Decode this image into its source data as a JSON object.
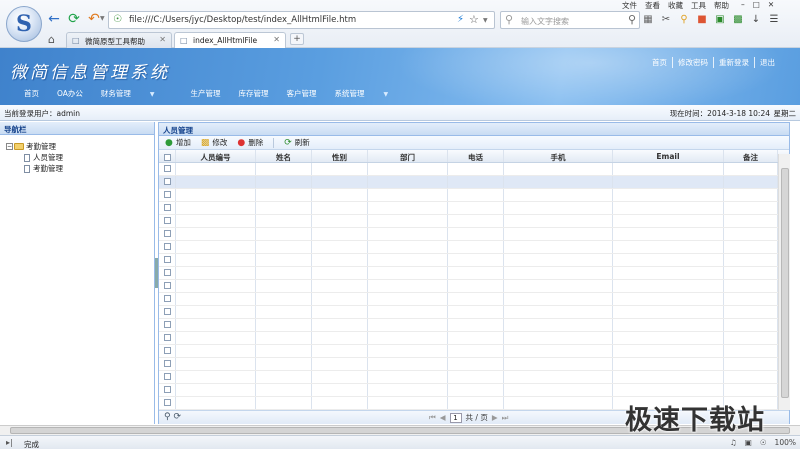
{
  "browser": {
    "url": "file:///C:/Users/jyc/Desktop/test/index_AllHtmlFile.htm",
    "search_placeholder": "输入文字搜索",
    "menu": [
      "文件",
      "查看",
      "收藏",
      "工具",
      "帮助"
    ],
    "tabs": [
      {
        "label": "微简原型工具帮助"
      },
      {
        "label": "index_AllHtmlFile"
      }
    ],
    "new_tab": "+"
  },
  "app": {
    "title": "微简信息管理系统",
    "top_links": [
      "首页",
      "修改密码",
      "重新登录",
      "退出"
    ],
    "nav": [
      "首页",
      "OA办公",
      "财务管理",
      "生产管理",
      "库存管理",
      "客户管理",
      "系统管理"
    ],
    "current_user": "当前登录用户：admin",
    "current_time": "现在时间：2014-3-18 10:24",
    "weekday": "星期二"
  },
  "left_panel": {
    "title": "导航栏",
    "tree": {
      "root": "考勤管理",
      "children": [
        "人员管理",
        "考勤管理"
      ]
    }
  },
  "right_panel": {
    "title": "人员管理",
    "toolbar": {
      "add": "增加",
      "edit": "修改",
      "delete": "删除",
      "refresh": "刷新"
    },
    "columns": [
      "人员编号",
      "姓名",
      "性别",
      "部门",
      "电话",
      "手机",
      "Email",
      "备注"
    ],
    "pager": {
      "page": "1",
      "total_text": "共 / 页"
    }
  },
  "status": {
    "text": "完成",
    "zoom": "100%"
  },
  "watermark": "极速下载站",
  "colors": {
    "header_blue": "#4a8fd6",
    "panel_border": "#99bbe8",
    "selected_row": "#dfe8f6"
  }
}
